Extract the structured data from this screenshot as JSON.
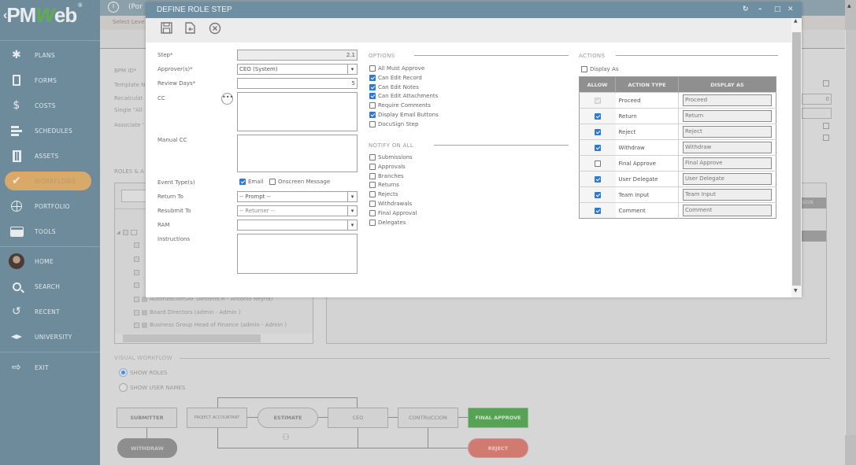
{
  "sidebar": {
    "logo": {
      "pre": "PM",
      "w": "W",
      "post": "eb",
      "reg": "®"
    },
    "items": [
      {
        "label": "PLANS",
        "icon": "lightbulb-icon",
        "glyph": "💡"
      },
      {
        "label": "FORMS",
        "icon": "document-icon",
        "glyph": "▯"
      },
      {
        "label": "COSTS",
        "icon": "dollar-icon",
        "glyph": "$"
      },
      {
        "label": "SCHEDULES",
        "icon": "schedule-bars-icon",
        "glyph": "☰"
      },
      {
        "label": "ASSETS",
        "icon": "building-icon",
        "glyph": "▦"
      },
      {
        "label": "WORKFLOWS",
        "icon": "checkmark-icon",
        "glyph": "✔"
      },
      {
        "label": "PORTFOLIO",
        "icon": "globe-icon",
        "glyph": "🌐"
      },
      {
        "label": "TOOLS",
        "icon": "toolbox-icon",
        "glyph": "▬"
      }
    ],
    "bottom_items": [
      {
        "label": "HOME",
        "icon": "avatar-icon"
      },
      {
        "label": "SEARCH",
        "icon": "search-icon",
        "glyph": "🔍"
      },
      {
        "label": "RECENT",
        "icon": "history-icon",
        "glyph": "↺"
      },
      {
        "label": "UNIVERSITY",
        "icon": "graduation-cap-icon",
        "glyph": "🎓"
      }
    ],
    "exit": {
      "label": "EXIT",
      "icon": "exit-icon",
      "glyph": "⇨"
    }
  },
  "background": {
    "header_title": "(Por",
    "sub": "Select Leve",
    "labels": [
      "BPM ID*",
      "Template N",
      "Recalculat",
      "Single \"All",
      "Associate '"
    ],
    "roles_section": "ROLES & A",
    "tree_rows": [
      "AutorizacionSAF (Antonio.R - Antonio Reyna)",
      "Board Directors (admin - Admin )",
      "Business Group Head of Finance (admin - Admin )"
    ],
    "right_value": "0",
    "right_col_header": "SIGN",
    "visual_workflow": {
      "title": "VISUAL WORKFLOW",
      "radio_roles": "SHOW ROLES",
      "radio_users": "SHOW USER NAMES",
      "nodes": {
        "submitter": "SUBMITTER",
        "withdraw": "WITHDRAW",
        "project_accountant": "PROJECT ACCOUNTANT",
        "estimate": "ESTIMATE",
        "ceo": "CEO",
        "contruccion": "CONTRUCCION",
        "final_approve": "FINAL APPROVE",
        "reject": "REJECT"
      }
    }
  },
  "modal": {
    "title": "DEFINE ROLE STEP",
    "toolbar": {
      "save": "save-icon",
      "export": "export-icon",
      "cancel": "cancel-icon"
    },
    "fields": {
      "step_label": "Step*",
      "step_value": "2.1",
      "approver_label": "Approver(s)*",
      "approver_value": "CEO (System)",
      "review_days_label": "Review Days*",
      "review_days_value": "5",
      "cc_label": "CC",
      "manual_cc_label": "Manual CC",
      "event_types_label": "Event Type(s)",
      "event_email": "Email",
      "event_email_checked": true,
      "event_onscreen": "Onscreen Message",
      "event_onscreen_checked": false,
      "return_to_label": "Return To",
      "return_to_value": "-- Prompt --",
      "resubmit_to_label": "Resubmit To",
      "resubmit_to_value": "-- Returner --",
      "ram_label": "RAM",
      "ram_value": "",
      "instructions_label": "Instructions"
    },
    "options": {
      "title": "OPTIONS",
      "items": [
        {
          "label": "All Must Approve",
          "checked": false
        },
        {
          "label": "Can Edit Record",
          "checked": true
        },
        {
          "label": "Can Edit Notes",
          "checked": true
        },
        {
          "label": "Can Edit Attachments",
          "checked": true
        },
        {
          "label": "Require Comments",
          "checked": false
        },
        {
          "label": "Display Email Buttons",
          "checked": true
        },
        {
          "label": "DocuSign Step",
          "checked": false
        }
      ]
    },
    "notify": {
      "title": "NOTIFY ON ALL",
      "items": [
        {
          "label": "Submissions",
          "checked": false
        },
        {
          "label": "Approvals",
          "checked": false
        },
        {
          "label": "Branches",
          "checked": false
        },
        {
          "label": "Returns",
          "checked": false
        },
        {
          "label": "Rejects",
          "checked": false
        },
        {
          "label": "Withdrawals",
          "checked": false
        },
        {
          "label": "Final Approval",
          "checked": false
        },
        {
          "label": "Delegates",
          "checked": false
        }
      ]
    },
    "actions": {
      "title": "ACTIONS",
      "display_as_label": "Display As",
      "display_as_checked": false,
      "columns": [
        "ALLOW",
        "ACTION TYPE",
        "DISPLAY AS"
      ],
      "rows": [
        {
          "allow": "disabled",
          "type": "Proceed",
          "display": "Proceed"
        },
        {
          "allow": "checked",
          "type": "Return",
          "display": "Return"
        },
        {
          "allow": "checked",
          "type": "Reject",
          "display": "Reject"
        },
        {
          "allow": "checked",
          "type": "Withdraw",
          "display": "Withdraw"
        },
        {
          "allow": "unchecked",
          "type": "Final Approve",
          "display": "Final Approve"
        },
        {
          "allow": "checked",
          "type": "User Delegate",
          "display": "User Delegate"
        },
        {
          "allow": "checked",
          "type": "Team Input",
          "display": "Team Input"
        },
        {
          "allow": "checked",
          "type": "Comment",
          "display": "Comment"
        }
      ]
    }
  }
}
